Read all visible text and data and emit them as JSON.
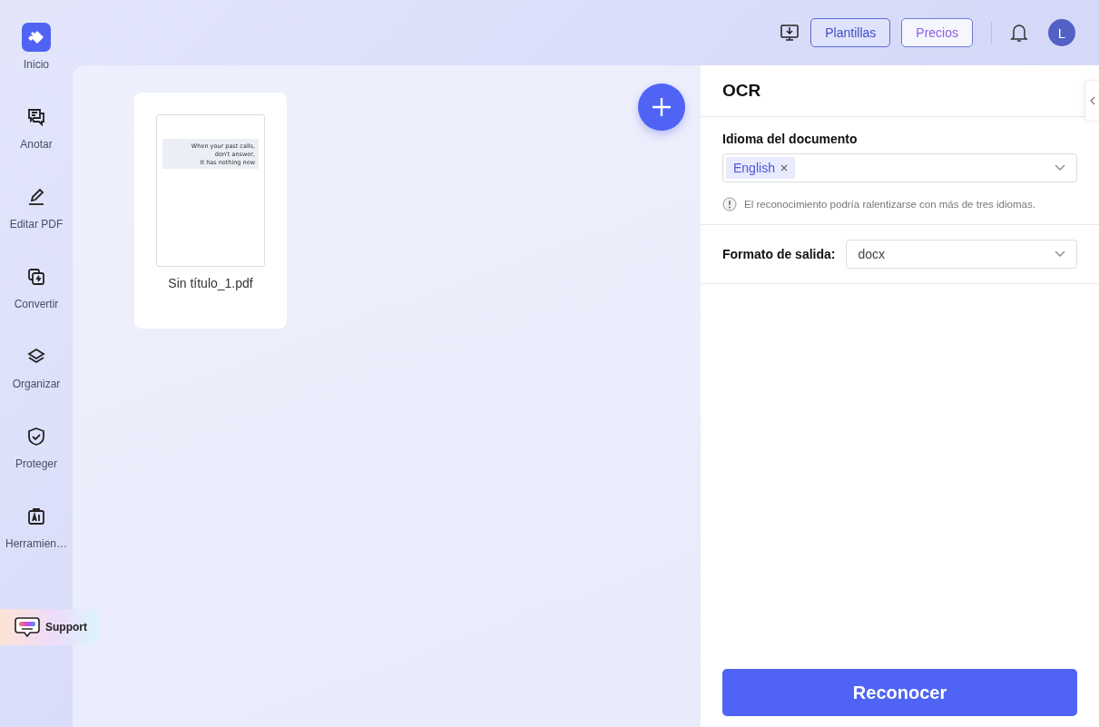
{
  "sidebar": {
    "items": [
      {
        "label": "Inicio"
      },
      {
        "label": "Anotar"
      },
      {
        "label": "Editar PDF"
      },
      {
        "label": "Convertir"
      },
      {
        "label": "Organizar"
      },
      {
        "label": "Proteger"
      },
      {
        "label": "Herramien…"
      }
    ],
    "support": {
      "label": "Support"
    }
  },
  "topbar": {
    "buttons": [
      {
        "label": "Plantillas",
        "kind": "primary"
      },
      {
        "label": "Precios",
        "kind": "secondary"
      }
    ],
    "avatar": "L"
  },
  "files": [
    {
      "name": "Sin título_1.pdf",
      "thumbnail_lines": [
        "When your past calls,",
        "don't answer,",
        "It has nothing new"
      ]
    }
  ],
  "panel": {
    "title": "OCR",
    "language_label": "Idioma del documento",
    "languages": [
      "English"
    ],
    "note": "El reconocimiento podría ralentizarse con más de tres idiomas.",
    "format_label": "Formato de salida:",
    "format_value": "docx",
    "action": "Reconocer"
  }
}
